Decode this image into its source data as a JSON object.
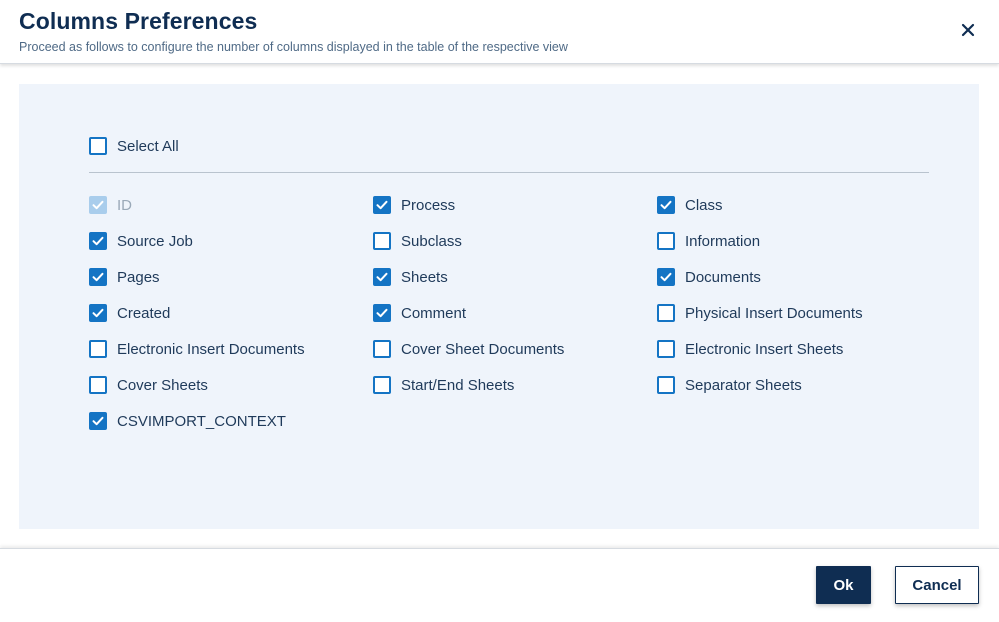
{
  "dialog": {
    "title": "Columns Preferences",
    "subtitle": "Proceed as follows to configure the number of columns displayed in the table of the respective view"
  },
  "select_all": {
    "label": "Select All",
    "checked": false
  },
  "columns": [
    {
      "label": "ID",
      "checked": true,
      "disabled": true
    },
    {
      "label": "Process",
      "checked": true,
      "disabled": false
    },
    {
      "label": "Class",
      "checked": true,
      "disabled": false
    },
    {
      "label": "Source Job",
      "checked": true,
      "disabled": false
    },
    {
      "label": "Subclass",
      "checked": false,
      "disabled": false
    },
    {
      "label": "Information",
      "checked": false,
      "disabled": false
    },
    {
      "label": "Pages",
      "checked": true,
      "disabled": false
    },
    {
      "label": "Sheets",
      "checked": true,
      "disabled": false
    },
    {
      "label": "Documents",
      "checked": true,
      "disabled": false
    },
    {
      "label": "Created",
      "checked": true,
      "disabled": false
    },
    {
      "label": "Comment",
      "checked": true,
      "disabled": false
    },
    {
      "label": "Physical Insert Documents",
      "checked": false,
      "disabled": false
    },
    {
      "label": "Electronic Insert Documents",
      "checked": false,
      "disabled": false
    },
    {
      "label": "Cover Sheet Documents",
      "checked": false,
      "disabled": false
    },
    {
      "label": "Electronic Insert Sheets",
      "checked": false,
      "disabled": false
    },
    {
      "label": "Cover Sheets",
      "checked": false,
      "disabled": false
    },
    {
      "label": "Start/End Sheets",
      "checked": false,
      "disabled": false
    },
    {
      "label": "Separator Sheets",
      "checked": false,
      "disabled": false
    },
    {
      "label": "CSVIMPORT_CONTEXT",
      "checked": true,
      "disabled": false
    }
  ],
  "footer": {
    "ok_label": "Ok",
    "cancel_label": "Cancel"
  },
  "icons": {
    "close": "close-icon",
    "check": "checkmark-icon"
  },
  "colors": {
    "accent": "#1474c4",
    "primary": "#0f2d52",
    "panel": "#eff4fb",
    "disabled": "#a9cdec"
  }
}
